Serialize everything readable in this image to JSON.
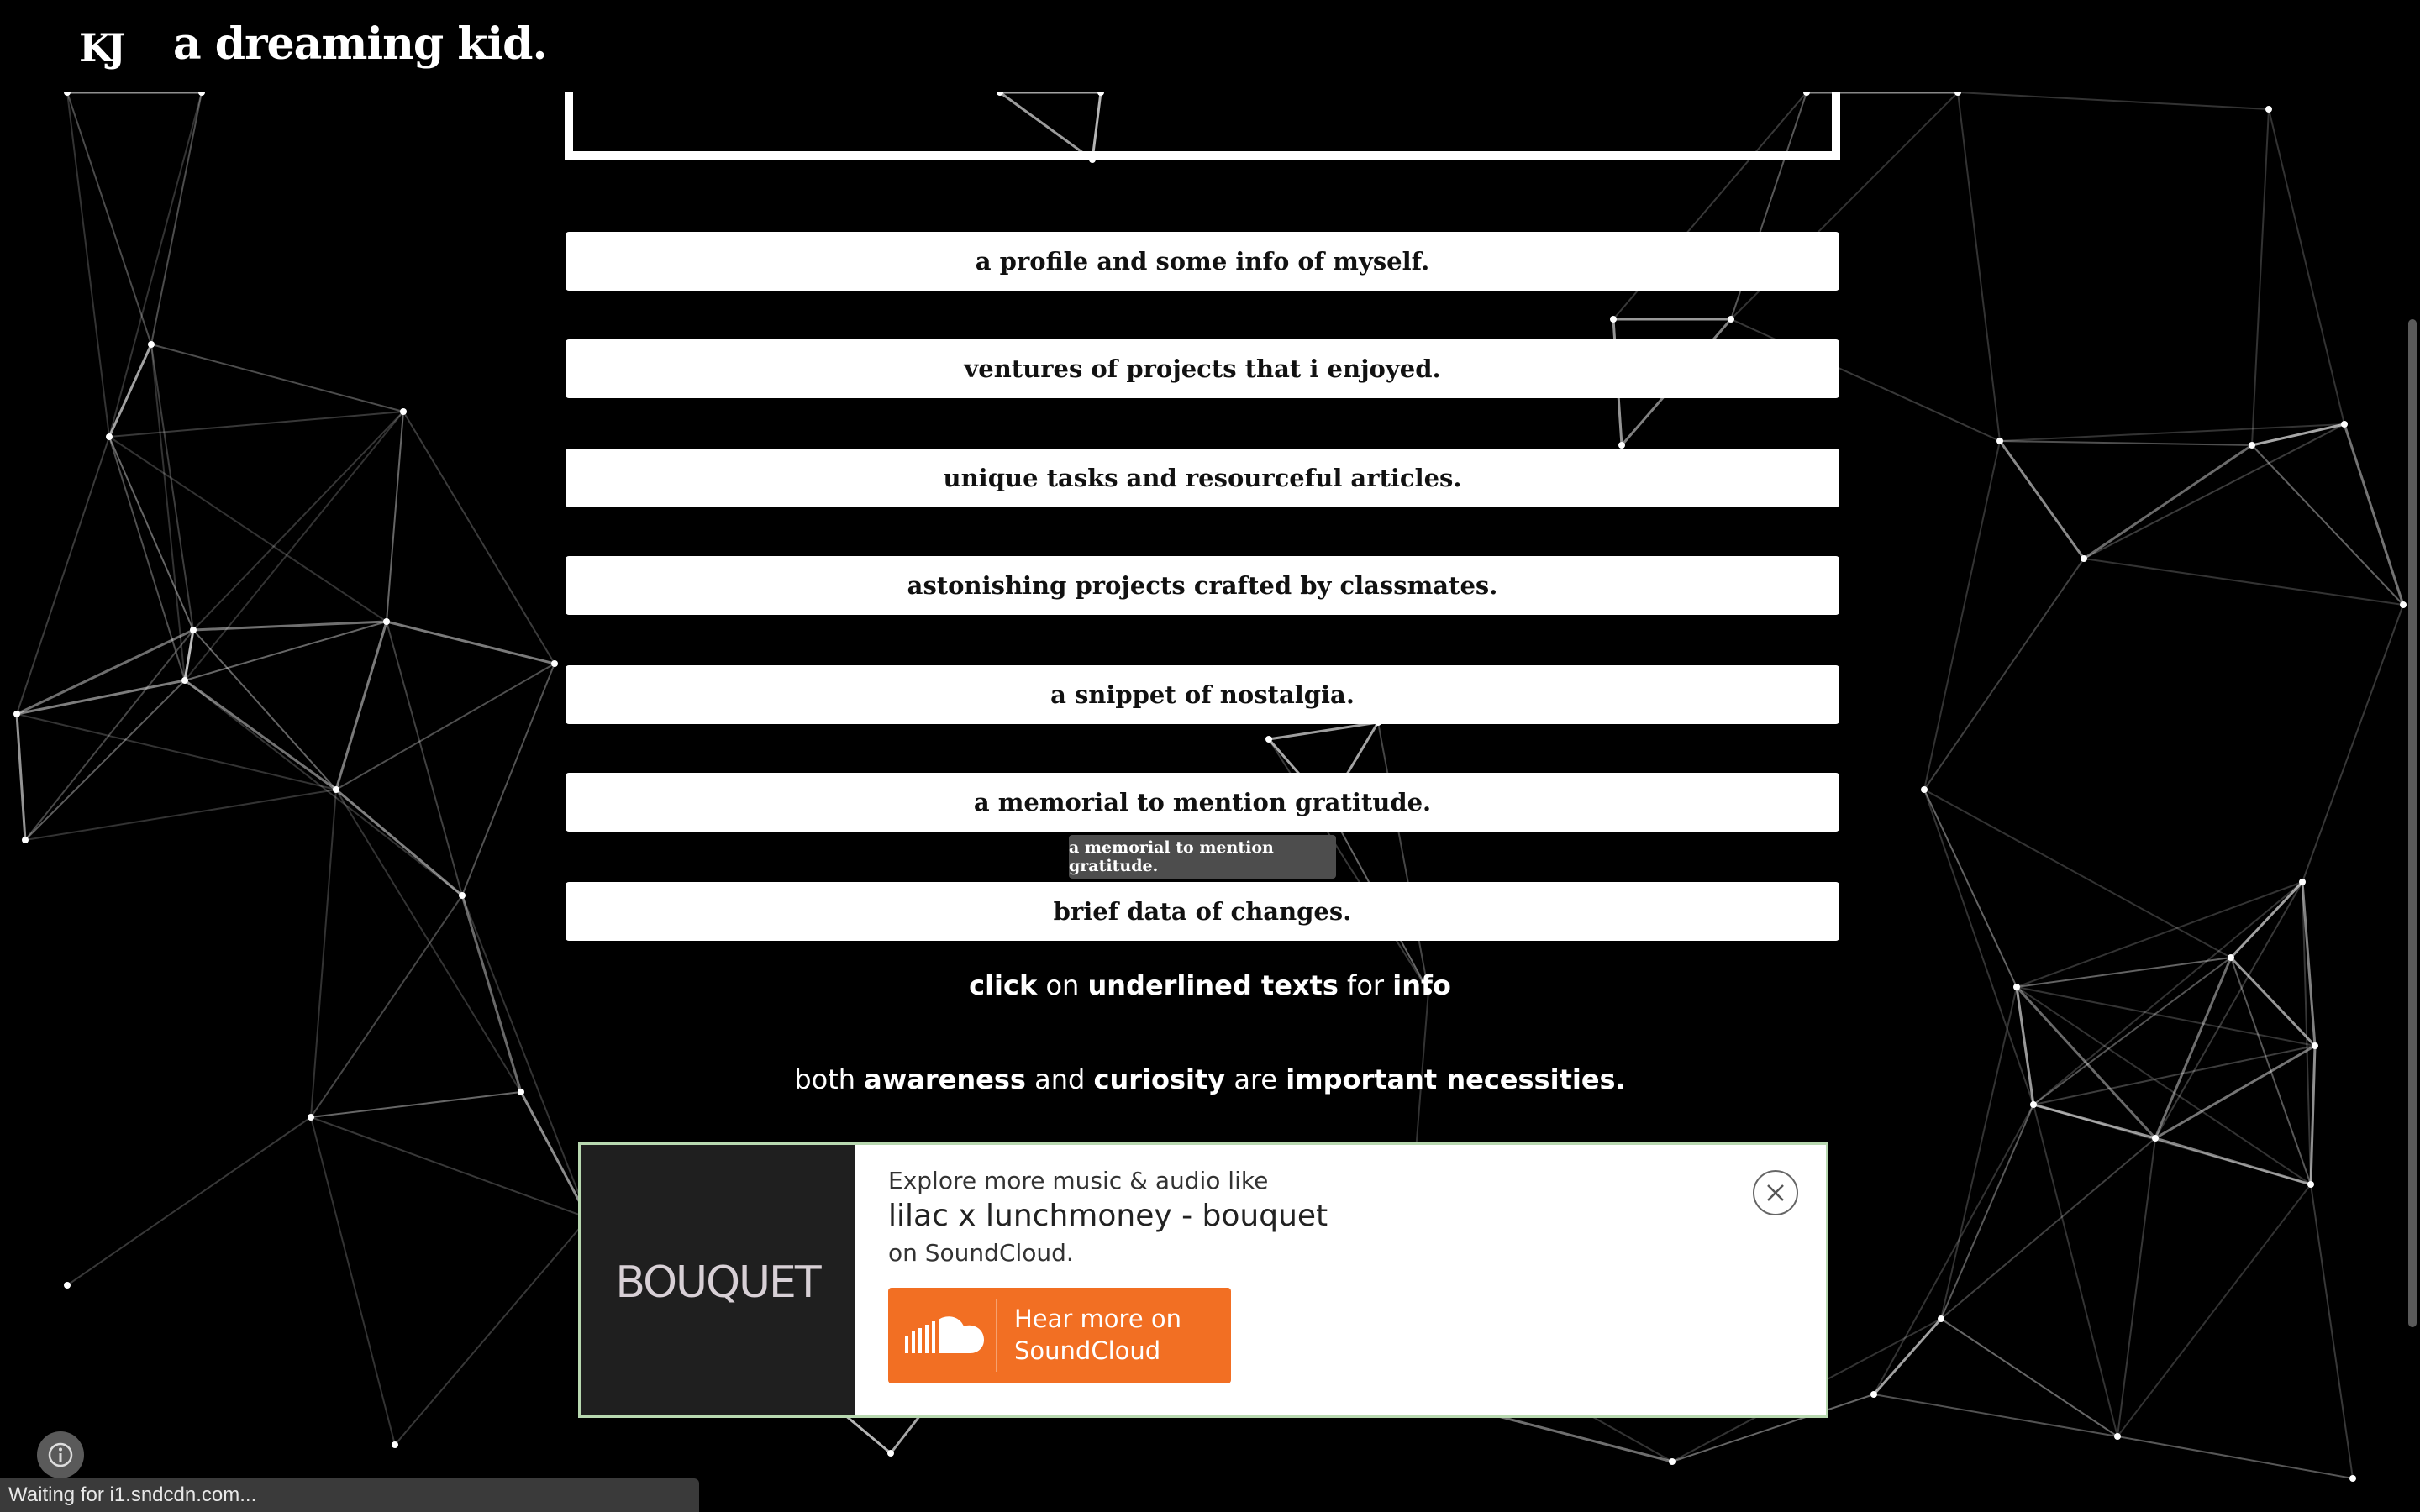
{
  "header": {
    "logo": "KJ",
    "title": "a dreaming kid."
  },
  "menu": {
    "items": [
      "a profile and some info of myself.",
      "ventures of projects that i enjoyed.",
      "unique tasks and resourceful articles.",
      "astonishing projects crafted by classmates.",
      "a snippet of nostalgia.",
      "a memorial to mention gratitude.",
      "brief data of changes."
    ],
    "tooltip": "a memorial to mention gratitude."
  },
  "info": {
    "line1": [
      "click",
      "on",
      "underlined texts",
      "for",
      "info"
    ],
    "line2": [
      "both",
      "awareness",
      "and",
      "curiosity",
      "are",
      "important necessities."
    ]
  },
  "soundcloud": {
    "art_text": "BOUQUET",
    "explore": "Explore more music & audio like",
    "track": "lilac x lunchmoney - bouquet",
    "on": "on SoundCloud.",
    "button": "Hear more on SoundCloud",
    "button_color": "#f26f23"
  },
  "status": {
    "text": "Waiting for i1.sndcdn.com..."
  },
  "icons": {
    "close": "close-icon",
    "info": "info-icon",
    "cloud": "soundcloud-logo-icon"
  }
}
